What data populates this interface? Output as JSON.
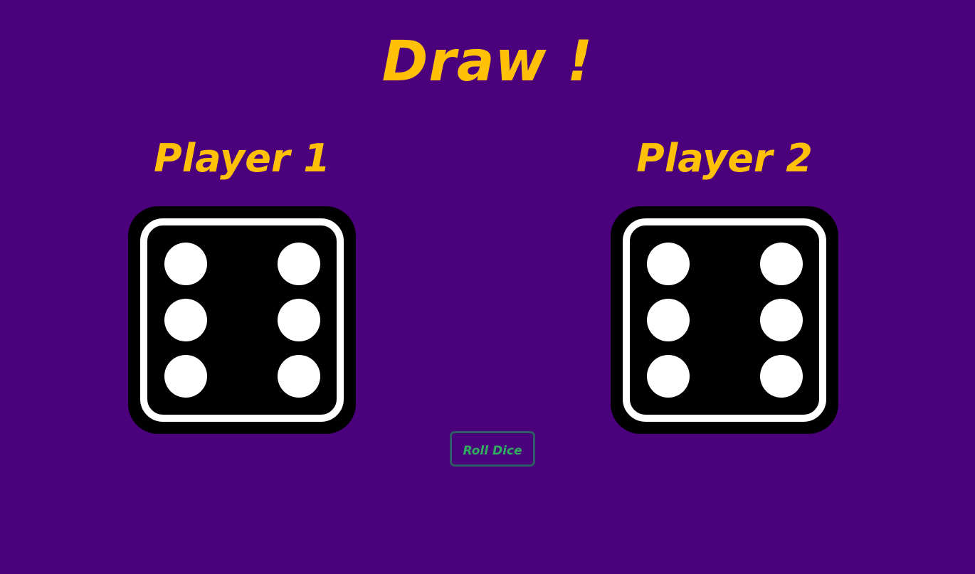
{
  "result": {
    "title": "Draw !"
  },
  "players": [
    {
      "name": "Player 1",
      "die_value": 6
    },
    {
      "name": "Player 2",
      "die_value": 6
    }
  ],
  "controls": {
    "roll_label": "Roll Dice"
  },
  "colors": {
    "background": "#4b007c",
    "title": "#ffc107",
    "die_body": "#000000",
    "die_pips": "#ffffff",
    "button_text": "#2fae60",
    "button_border": "#2e5d64"
  }
}
